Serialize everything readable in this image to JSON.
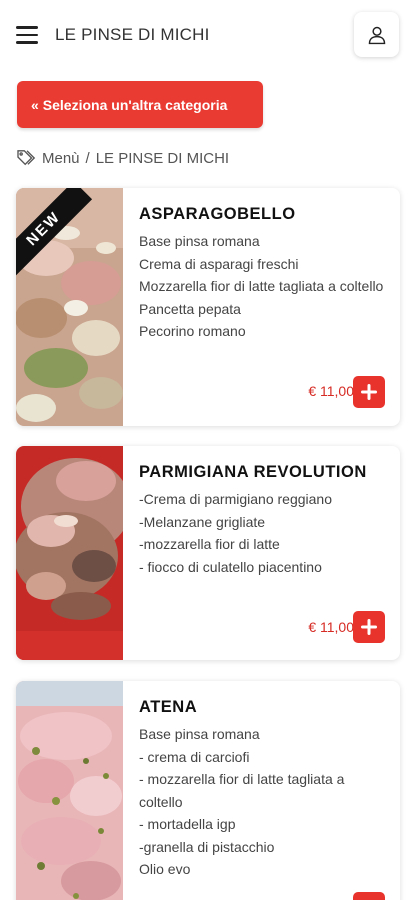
{
  "header": {
    "title": "LE PINSE DI MICHI",
    "menu_icon": "hamburger-menu-icon",
    "user_icon": "user-icon"
  },
  "category_button": {
    "chevron": "«",
    "label": "Seleziona un'altra categoria"
  },
  "breadcrumb": {
    "icon": "tags-icon",
    "items": [
      "Menù",
      "/",
      "LE PINSE DI MICHI"
    ]
  },
  "colors": {
    "accent": "#ea3b32",
    "price": "#d62b24"
  },
  "products": [
    {
      "name": "ASPARAGOBELLO",
      "badge": "NEW",
      "description": [
        "Base pinsa romana",
        "Crema di asparagi freschi",
        "Mozzarella fior di latte tagliata a coltello",
        "Pancetta pepata",
        "Pecorino romano"
      ],
      "price": "€ 11,00"
    },
    {
      "name": "PARMIGIANA REVOLUTION",
      "description": [
        "-Crema di parmigiano reggiano",
        "-Melanzane grigliate",
        "-mozzarella fior di latte",
        "- fiocco di culatello piacentino"
      ],
      "price": "€ 11,00"
    },
    {
      "name": "ATENA",
      "description": [
        "Base pinsa romana",
        "- crema di carciofi",
        "- mozzarella fior di latte tagliata a coltello",
        "- mortadella igp",
        "-granella di pistacchio",
        "Olio evo"
      ],
      "price": ""
    }
  ]
}
